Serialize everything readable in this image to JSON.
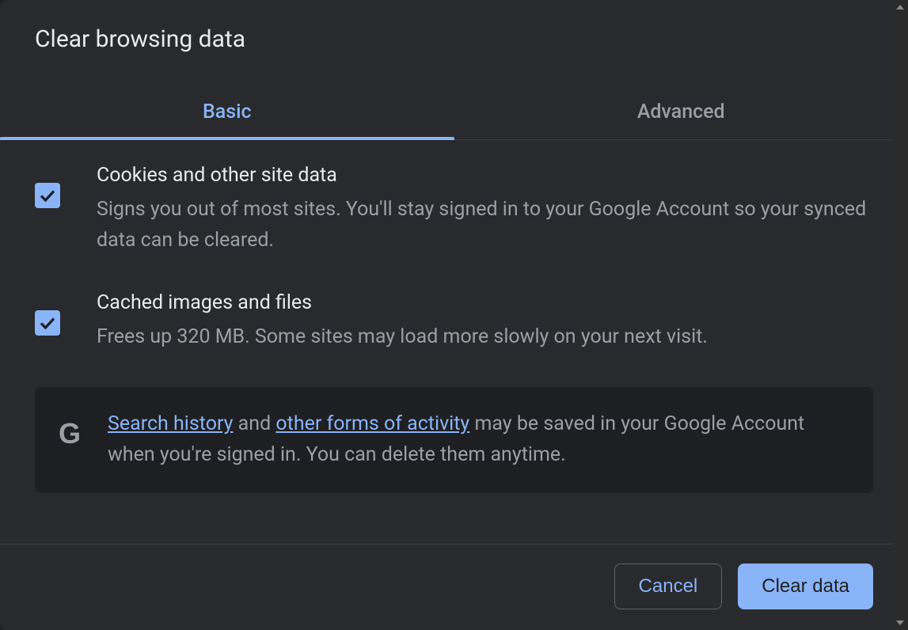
{
  "dialog": {
    "title": "Clear browsing data"
  },
  "tabs": {
    "basic": "Basic",
    "advanced": "Advanced",
    "active": "basic"
  },
  "options": {
    "cookies": {
      "checked": true,
      "title": "Cookies and other site data",
      "description": "Signs you out of most sites. You'll stay signed in to your Google Account so your synced data can be cleared."
    },
    "cache": {
      "checked": true,
      "title": "Cached images and files",
      "description": "Frees up 320 MB. Some sites may load more slowly on your next visit."
    }
  },
  "info": {
    "link1": "Search history",
    "mid1": " and ",
    "link2": "other forms of activity",
    "rest": " may be saved in your Google Account when you're signed in. You can delete them anytime."
  },
  "buttons": {
    "cancel": "Cancel",
    "clear": "Clear data"
  }
}
